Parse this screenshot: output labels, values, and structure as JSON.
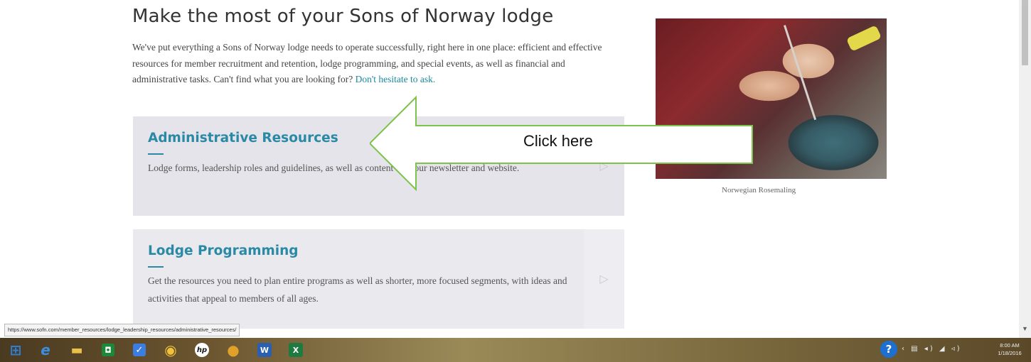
{
  "intro": {
    "title": "Make the most of your Sons of Norway lodge",
    "text": "We've put everything a Sons of Norway lodge needs to operate successfully, right here in one place: efficient and effective resources for member recruitment and retention, lodge programming, and special events, as well as financial and administrative tasks. Can't find what you are looking for?",
    "ask_link": "Don't hesitate to ask."
  },
  "cards": [
    {
      "title": "Administrative Resources",
      "description": "Lodge forms, leadership roles and guidelines, as well as content for your newsletter and website.",
      "arrow": "▷"
    },
    {
      "title": "Lodge Programming",
      "description": "Get the resources you need to plan entire programs as well as shorter, more focused segments, with ideas and activities that appeal to members of all ages.",
      "arrow": "▷"
    }
  ],
  "photo": {
    "caption": "Norwegian Rosemaling"
  },
  "annotation": {
    "label": "Click here",
    "stroke_color": "#7dc24b"
  },
  "status_bar": {
    "url": "https://www.sofn.com/member_resources/lodge_leadership_resources/administrative_resources/"
  },
  "taskbar": {
    "items": [
      {
        "icon": "windows-start-icon",
        "glyph": "⊞",
        "color": "#2b7fd6"
      },
      {
        "icon": "internet-explorer-icon",
        "glyph": "e",
        "color": "#3a8fe0"
      },
      {
        "icon": "file-explorer-icon",
        "glyph": "▬",
        "color": "#e8c04a"
      },
      {
        "icon": "store-icon",
        "glyph": "◘",
        "color": "#1a8a3a"
      },
      {
        "icon": "app-check-icon",
        "glyph": "✓",
        "color": "#3b7de0"
      },
      {
        "icon": "media-icon",
        "glyph": "◉",
        "color": "#8a5a1a"
      },
      {
        "icon": "hp-icon",
        "glyph": "hp",
        "color": "#1a1a1a"
      },
      {
        "icon": "chrome-icon",
        "glyph": "●",
        "color": "#e0a02a"
      },
      {
        "icon": "word-icon",
        "glyph": "W",
        "color": "#2b5fb0"
      },
      {
        "icon": "excel-icon",
        "glyph": "X",
        "color": "#1f7a40"
      }
    ],
    "help_glyph": "?",
    "clock_time": "8:00 AM",
    "clock_date": "1/18/2016"
  },
  "colors": {
    "accent": "#2a8aa6",
    "card_bg": "#e4e4ea"
  }
}
